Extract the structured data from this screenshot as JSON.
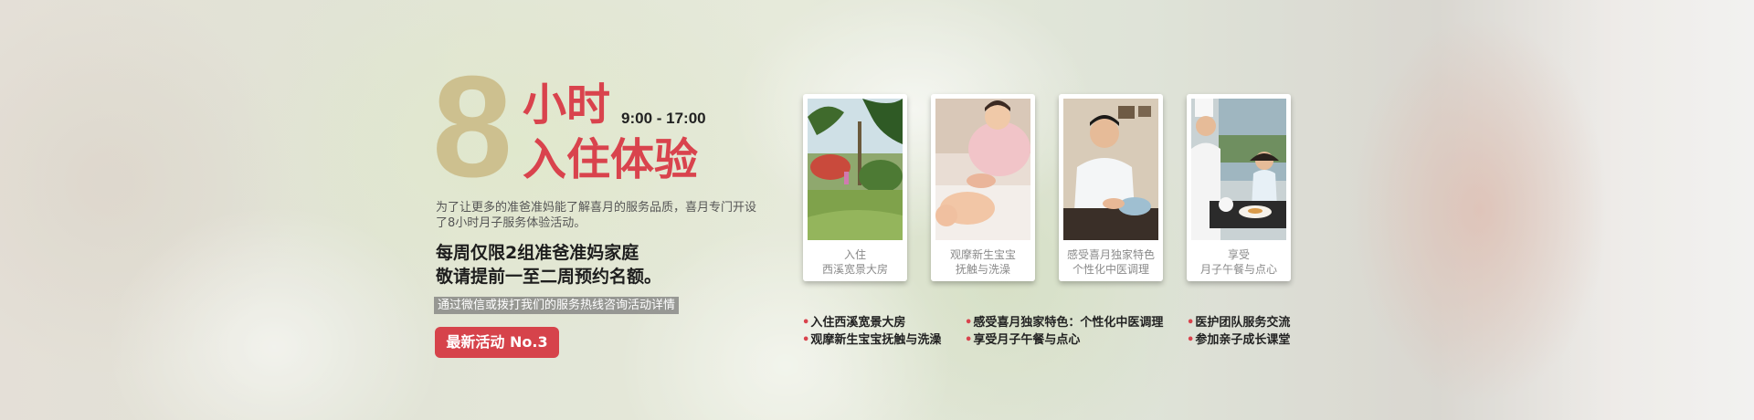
{
  "hero": {
    "number": "8",
    "title_line1": "小时",
    "time_range": "9:00 - 17:00",
    "title_line2": "入住体验",
    "intro": "为了让更多的准爸准妈能了解喜月的服务品质，喜月专门开设了8小时月子服务体验活动。",
    "limit_line1": "每周仅限2组准爸准妈家庭",
    "limit_line2": "敬请提前一至二周预约名额。",
    "hint": "通过微信或拨打我们的服务热线咨询活动详情",
    "cta": "最新活动  No.3"
  },
  "cards": [
    {
      "line1": "入住",
      "line2": "西溪宽景大房",
      "icon": "garden-photo"
    },
    {
      "line1": "观摩新生宝宝",
      "line2": "抚触与洗澡",
      "icon": "baby-massage-photo"
    },
    {
      "line1": "感受喜月独家特色",
      "line2": "个性化中医调理",
      "icon": "doctor-photo"
    },
    {
      "line1": "享受",
      "line2": "月子午餐与点心",
      "icon": "chef-meal-photo"
    }
  ],
  "features": {
    "col1": [
      "入住西溪宽景大房",
      "观摩新生宝宝抚触与洗澡"
    ],
    "col2": [
      "感受喜月独家特色：个性化中医调理",
      "享受月子午餐与点心"
    ],
    "col3": [
      "医护团队服务交流",
      "参加亲子成长课堂"
    ]
  },
  "colors": {
    "accent": "#d9434d",
    "gold": "#cdc08f"
  }
}
